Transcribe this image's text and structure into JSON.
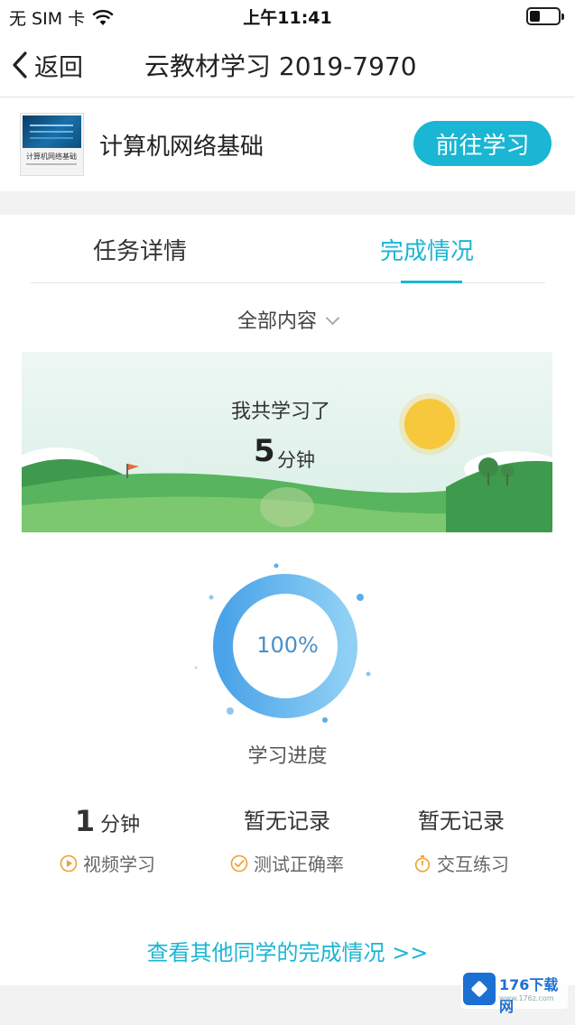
{
  "status_bar": {
    "carrier": "无 SIM 卡",
    "time": "上午11:41",
    "wifi_icon": "wifi-icon",
    "battery_icon": "battery-icon",
    "battery_level": 0.35
  },
  "nav": {
    "back_label": "返回",
    "title": "云教材学习 2019-7970"
  },
  "course": {
    "thumb_caption": "计算机网络基础",
    "name": "计算机网络基础",
    "go_button": "前往学习"
  },
  "tabs": [
    {
      "label": "任务详情",
      "active": false
    },
    {
      "label": "完成情况",
      "active": true
    }
  ],
  "filter": {
    "label": "全部内容"
  },
  "banner": {
    "line1": "我共学习了",
    "number": "5",
    "unit": "分钟"
  },
  "progress": {
    "percent_text": "100%",
    "percent_value": 1.0,
    "label": "学习进度"
  },
  "stats": [
    {
      "big": "1",
      "unit": "分钟",
      "text": "",
      "caption": "视频学习",
      "icon": "play-icon"
    },
    {
      "big": "",
      "unit": "",
      "text": "暂无记录",
      "caption": "测试正确率",
      "icon": "check-circle-icon"
    },
    {
      "big": "",
      "unit": "",
      "text": "暂无记录",
      "caption": "交互练习",
      "icon": "stopwatch-icon"
    }
  ],
  "more_link": "查看其他同学的完成情况 >>",
  "watermark": {
    "text": "176下载网",
    "sub": "www.176z.com"
  },
  "colors": {
    "accent": "#1ab6d3",
    "ring_start": "#4aa3e8",
    "ring_end": "#8fd0f5",
    "icon_orange": "#f0a030"
  }
}
